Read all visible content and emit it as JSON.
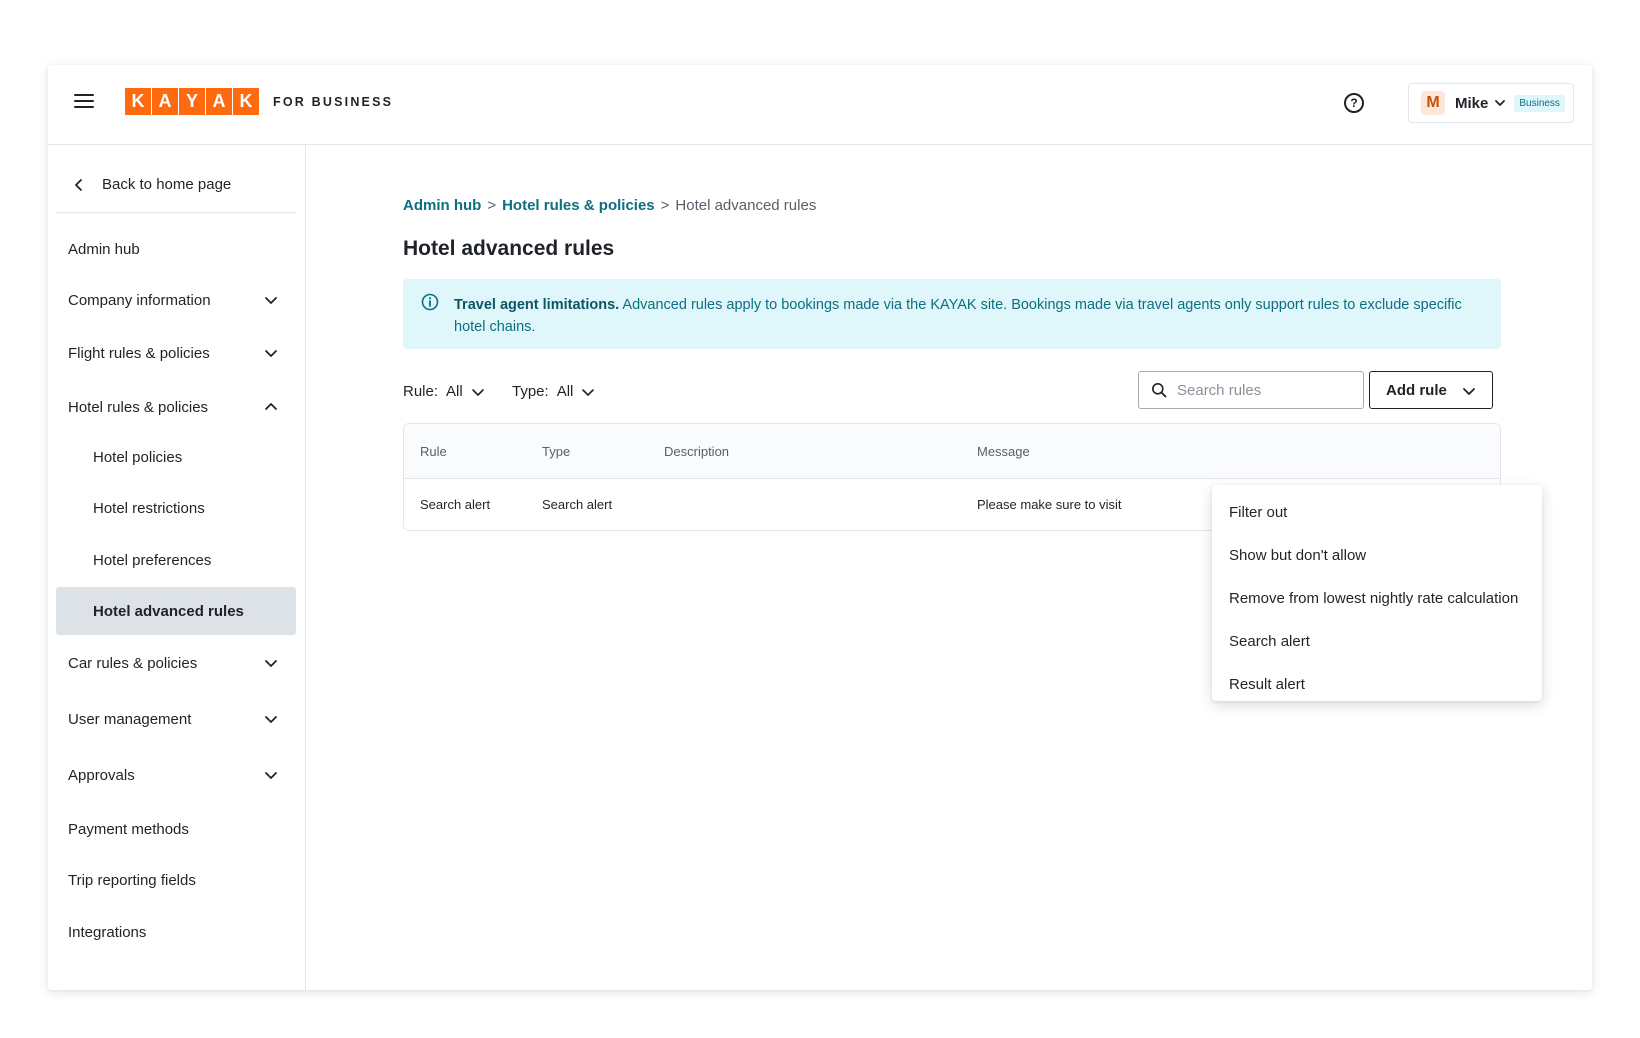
{
  "header": {
    "logo_letters": [
      "K",
      "A",
      "Y",
      "A",
      "K"
    ],
    "brand_suffix": "FOR BUSINESS",
    "help_glyph": "?",
    "account": {
      "initial": "M",
      "name": "Mike",
      "badge": "Business"
    }
  },
  "sidebar": {
    "back_label": "Back to home page",
    "items": [
      {
        "label": "Admin hub"
      },
      {
        "label": "Company information"
      },
      {
        "label": "Flight rules & policies"
      },
      {
        "label": "Hotel rules & policies"
      },
      {
        "label": "Hotel policies"
      },
      {
        "label": "Hotel restrictions"
      },
      {
        "label": "Hotel preferences"
      },
      {
        "label": "Hotel advanced rules"
      },
      {
        "label": "Car rules & policies"
      },
      {
        "label": "User management"
      },
      {
        "label": "Approvals"
      },
      {
        "label": "Payment methods"
      },
      {
        "label": "Trip reporting fields"
      },
      {
        "label": "Integrations"
      }
    ]
  },
  "breadcrumb": {
    "items": [
      "Admin hub",
      "Hotel rules & policies",
      "Hotel advanced rules"
    ],
    "separator": ">"
  },
  "page": {
    "title": "Hotel advanced rules"
  },
  "banner": {
    "title": "Travel agent limitations.",
    "text": "Advanced rules apply to bookings made via the KAYAK site. Bookings made via travel agents only support rules to exclude specific hotel chains."
  },
  "filters": {
    "rule": {
      "label": "Rule:",
      "value": "All"
    },
    "type": {
      "label": "Type:",
      "value": "All"
    }
  },
  "search": {
    "placeholder": "Search rules"
  },
  "add_rule": {
    "label": "Add rule",
    "options": [
      "Filter out",
      "Show but don't allow",
      "Remove from lowest nightly rate calculation",
      "Search alert",
      "Result alert"
    ]
  },
  "table": {
    "columns": [
      "Rule",
      "Type",
      "Description",
      "Message"
    ],
    "rows": [
      {
        "rule": "Search alert",
        "type": "Search alert",
        "description": "",
        "message": "Please make sure to visit thi"
      }
    ]
  },
  "colors": {
    "brand_orange": "#ff690f",
    "link_teal": "#0d6f80",
    "banner_bg": "#dff6fb",
    "active_nav_bg": "#dde2e7"
  }
}
